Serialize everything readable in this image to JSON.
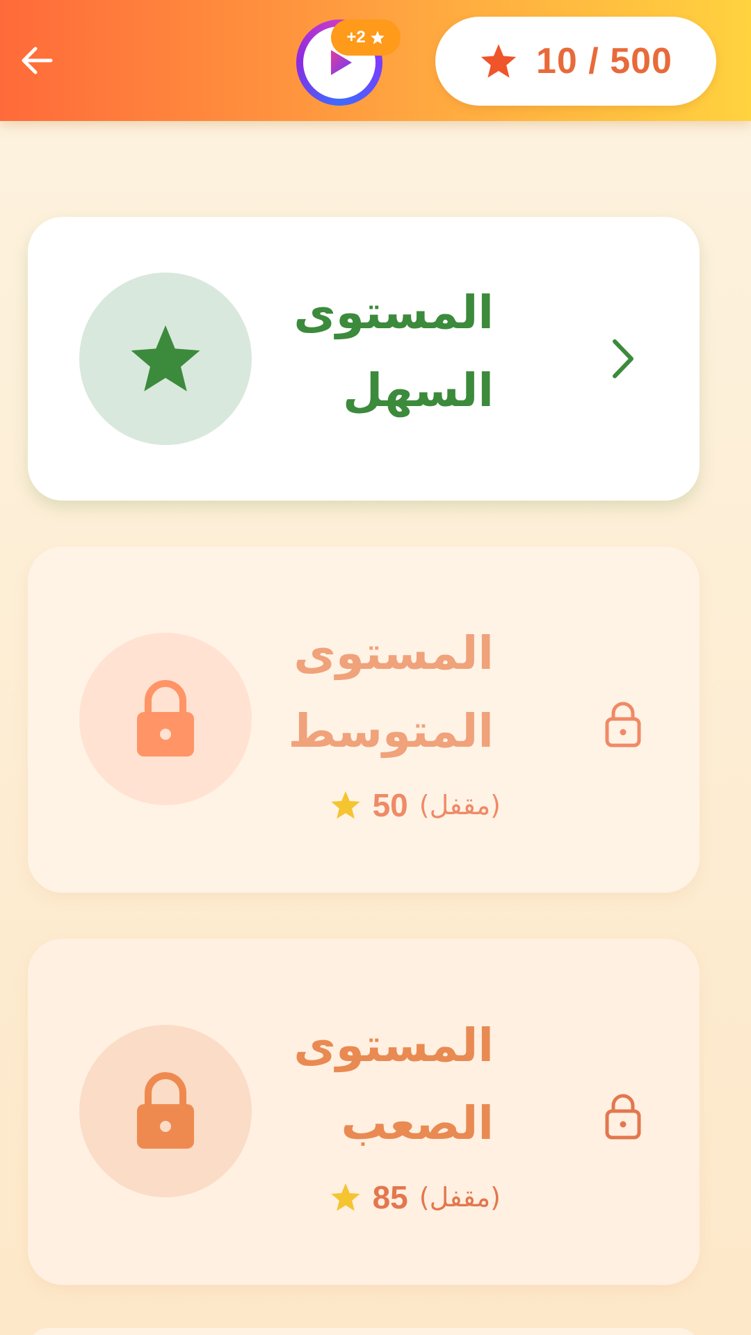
{
  "header": {
    "back_icon": "arrow-left-icon",
    "video_reward": {
      "icon": "play-video-icon",
      "badge": "+2"
    },
    "score": {
      "icon": "star-icon",
      "text": "10 / 500"
    }
  },
  "levels": [
    {
      "title_line1": "المستوى",
      "title_line2": "السهل",
      "icon": "star-icon",
      "state": "unlocked",
      "color": "#3c8a3c"
    },
    {
      "title_line1": "المستوى",
      "title_line2": "المتوسط",
      "icon": "lock-icon",
      "state": "locked",
      "locked_label": "(مقفل)",
      "required_stars": "50",
      "color": "#f0a27a"
    },
    {
      "title_line1": "المستوى",
      "title_line2": "الصعب",
      "icon": "lock-icon",
      "state": "locked",
      "locked_label": "(مقفل)",
      "required_stars": "85",
      "color": "#e98a52"
    }
  ],
  "colors": {
    "accent_orange": "#e86a3a",
    "green": "#3c8a3c",
    "star_yellow": "#f5c431"
  }
}
